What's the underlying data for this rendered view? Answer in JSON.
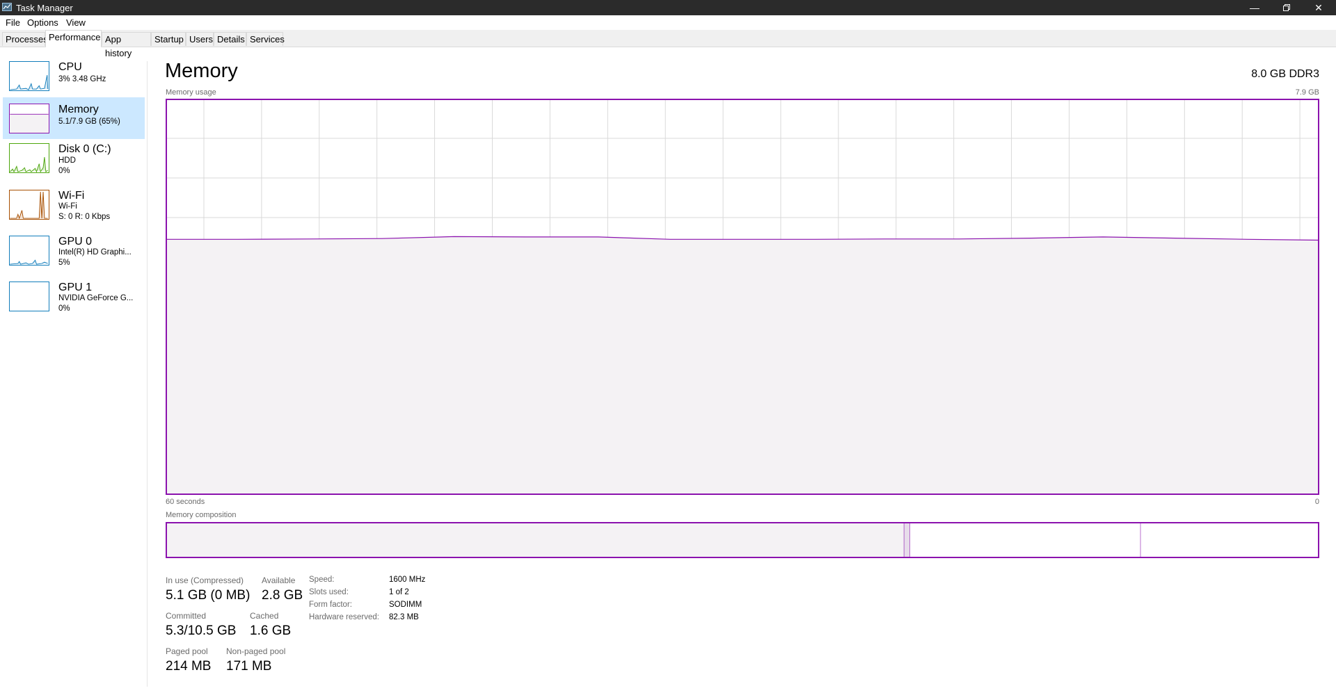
{
  "window": {
    "title": "Task Manager",
    "app_icon": "task-manager-icon",
    "controls": [
      "minimize-icon",
      "restore-icon",
      "close-icon"
    ]
  },
  "menu": [
    "File",
    "Options",
    "View"
  ],
  "tabs": [
    {
      "label": "Processes",
      "active": false
    },
    {
      "label": "Performance",
      "active": true
    },
    {
      "label": "App history",
      "active": false
    },
    {
      "label": "Startup",
      "active": false
    },
    {
      "label": "Users",
      "active": false
    },
    {
      "label": "Details",
      "active": false
    },
    {
      "label": "Services",
      "active": false
    }
  ],
  "sidebar": {
    "items": [
      {
        "name": "CPU",
        "line1": "3% 3.48 GHz",
        "line2": "",
        "color": "#117dbb"
      },
      {
        "name": "Memory",
        "line1": "5.1/7.9 GB (65%)",
        "line2": "",
        "color": "#8b12ae",
        "selected": true
      },
      {
        "name": "Disk 0 (C:)",
        "line1": "HDD",
        "line2": "0%",
        "color": "#4da60c"
      },
      {
        "name": "Wi-Fi",
        "line1": "Wi-Fi",
        "line2": "S: 0 R: 0 Kbps",
        "color": "#a74f01"
      },
      {
        "name": "GPU 0",
        "line1": "Intel(R) HD Graphi...",
        "line2": "5%",
        "color": "#117dbb"
      },
      {
        "name": "GPU 1",
        "line1": "NVIDIA GeForce G...",
        "line2": "0%",
        "color": "#117dbb"
      }
    ]
  },
  "main": {
    "title": "Memory",
    "spec": "8.0 GB DDR3",
    "usage_label": "Memory usage",
    "max_label": "7.9 GB",
    "time_left": "60 seconds",
    "time_right": "0",
    "composition_label": "Memory composition",
    "stats": {
      "in_use_label": "In use (Compressed)",
      "in_use_value": "5.1 GB (0 MB)",
      "available_label": "Available",
      "available_value": "2.8 GB",
      "committed_label": "Committed",
      "committed_value": "5.3/10.5 GB",
      "cached_label": "Cached",
      "cached_value": "1.6 GB",
      "paged_label": "Paged pool",
      "paged_value": "214 MB",
      "nonpaged_label": "Non-paged pool",
      "nonpaged_value": "171 MB"
    },
    "specs": [
      {
        "label": "Speed:",
        "value": "1600 MHz"
      },
      {
        "label": "Slots used:",
        "value": "1 of 2"
      },
      {
        "label": "Form factor:",
        "value": "SODIMM"
      },
      {
        "label": "Hardware reserved:",
        "value": "82.3 MB"
      }
    ]
  },
  "colors": {
    "memory_accent": "#8b12ae",
    "memory_fill": "#f4f2f4",
    "grid": "#d9d9d9",
    "selected_bg": "#cce8ff",
    "titlebar": "#2b2b2b"
  },
  "chart_data": {
    "type": "area",
    "title": "Memory usage",
    "x_range_seconds": [
      60,
      0
    ],
    "ylim": [
      0,
      7.9
    ],
    "y_unit": "GB",
    "usage_fraction": [
      0.645,
      0.645,
      0.646,
      0.647,
      0.652,
      0.651,
      0.651,
      0.645,
      0.645,
      0.645,
      0.646,
      0.646,
      0.648,
      0.651,
      0.648,
      0.645,
      0.643
    ],
    "composition_fraction": {
      "in_use": 0.64,
      "modified": 0.005,
      "standby": 0.2,
      "free": 0.155
    }
  }
}
